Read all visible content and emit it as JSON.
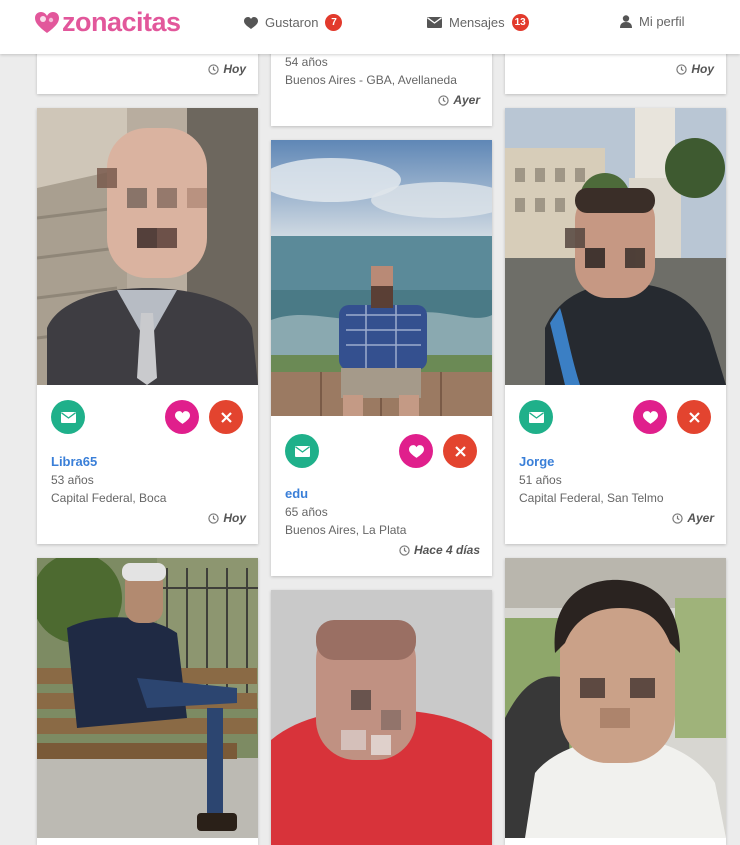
{
  "header": {
    "logo_part1": "zona",
    "logo_part2": "citas",
    "nav": {
      "liked_label": "Gustaron",
      "liked_count": "7",
      "messages_label": "Mensajes",
      "messages_count": "13",
      "profile_label": "Mi perfil"
    }
  },
  "colors": {
    "brand": "#e2579b",
    "message_button": "#1fb08a",
    "like_button": "#e01f8c",
    "dismiss_button": "#e3442f",
    "name_link": "#3a7fd8",
    "badge": "#e23a2c"
  },
  "top_row": {
    "left": {
      "when": "Hoy"
    },
    "middle": {
      "age": "54 años",
      "location": "Buenos Aires - GBA, Avellaneda",
      "when": "Ayer"
    },
    "right": {
      "when": "Hoy"
    }
  },
  "profiles": [
    {
      "name": "Libra65",
      "age": "53 años",
      "location": "Capital Federal, Boca",
      "when": "Hoy"
    },
    {
      "name": "edu",
      "age": "65 años",
      "location": "Buenos Aires, La Plata",
      "when": "Hace 4 días"
    },
    {
      "name": "Jorge",
      "age": "51 años",
      "location": "Capital Federal, San Telmo",
      "when": "Ayer"
    }
  ],
  "icons": {
    "message": "envelope-icon",
    "like": "heart-icon",
    "dismiss": "close-icon",
    "time": "clock-icon",
    "profile": "user-icon"
  }
}
